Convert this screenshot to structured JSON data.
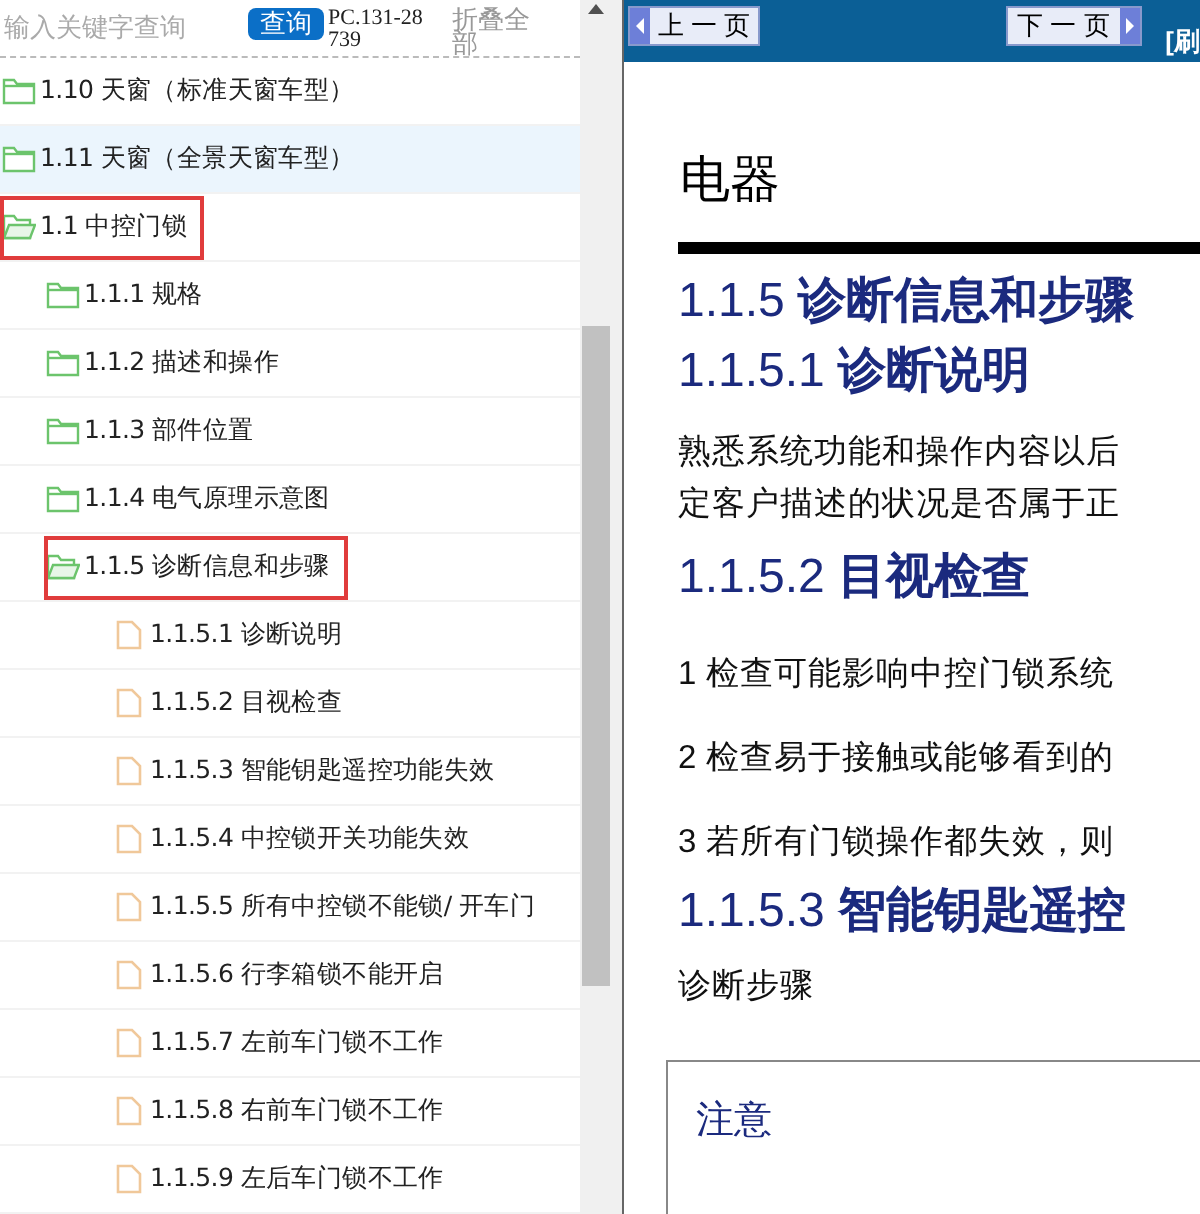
{
  "search": {
    "placeholder": "输入关键字查询",
    "button": "查询",
    "doc_code": "PC.131-28739",
    "collapse_all": "折叠全部"
  },
  "tree": [
    {
      "kind": "folder",
      "label": "1.10 天窗（标准天窗车型）",
      "expanded": false,
      "selected": false,
      "boxed": false
    },
    {
      "kind": "folder",
      "label": "1.11 天窗（全景天窗车型）",
      "expanded": false,
      "selected": true,
      "boxed": false
    },
    {
      "kind": "folder",
      "label": "1.1 中控门锁",
      "expanded": true,
      "selected": false,
      "boxed": true,
      "children": [
        {
          "kind": "folder",
          "label": "1.1.1 规格",
          "expanded": false,
          "selected": false,
          "boxed": false
        },
        {
          "kind": "folder",
          "label": "1.1.2 描述和操作",
          "expanded": false,
          "selected": false,
          "boxed": false
        },
        {
          "kind": "folder",
          "label": "1.1.3 部件位置",
          "expanded": false,
          "selected": false,
          "boxed": false
        },
        {
          "kind": "folder",
          "label": "1.1.4 电气原理示意图",
          "expanded": false,
          "selected": false,
          "boxed": false
        },
        {
          "kind": "folder",
          "label": "1.1.5 诊断信息和步骤",
          "expanded": true,
          "selected": false,
          "boxed": true,
          "children": [
            {
              "kind": "file",
              "label": "1.1.5.1 诊断说明",
              "selected": false,
              "boxed": false
            },
            {
              "kind": "file",
              "label": "1.1.5.2 目视检查",
              "selected": false,
              "boxed": false
            },
            {
              "kind": "file",
              "label": "1.1.5.3 智能钥匙遥控功能失效",
              "selected": false,
              "boxed": false
            },
            {
              "kind": "file",
              "label": "1.1.5.4 中控锁开关功能失效",
              "selected": false,
              "boxed": false
            },
            {
              "kind": "file",
              "label": "1.1.5.5 所有中控锁不能锁/ 开车门",
              "selected": false,
              "boxed": false
            },
            {
              "kind": "file",
              "label": "1.1.5.6 行李箱锁不能开启",
              "selected": false,
              "boxed": false
            },
            {
              "kind": "file",
              "label": "1.1.5.7 左前车门锁不工作",
              "selected": false,
              "boxed": false
            },
            {
              "kind": "file",
              "label": "1.1.5.8 右前车门锁不工作",
              "selected": false,
              "boxed": false
            },
            {
              "kind": "file",
              "label": "1.1.5.9 左后车门锁不工作",
              "selected": false,
              "boxed": false
            }
          ]
        }
      ]
    }
  ],
  "nav": {
    "prev": "上 一 页",
    "next": "下 一 页",
    "refresh": "[刷"
  },
  "content": [
    {
      "kind": "title",
      "text": "电器"
    },
    {
      "kind": "rule"
    },
    {
      "kind": "heading",
      "text": "1.1.5 **诊断信息和步骤**"
    },
    {
      "kind": "heading",
      "text": "1.1.5.1 **诊断说明**"
    },
    {
      "kind": "paragraph",
      "lines": [
        "熟悉系统功能和操作内容以后",
        "定客户描述的状况是否属于正"
      ]
    },
    {
      "kind": "heading",
      "text": "1.1.5.2 **目视检查**"
    },
    {
      "kind": "step",
      "text": "1 检查可能影响中控门锁系统"
    },
    {
      "kind": "step",
      "text": "2 检查易于接触或能够看到的"
    },
    {
      "kind": "step",
      "text": "3 若所有门锁操作都失效，则"
    },
    {
      "kind": "heading",
      "text": "1.1.5.3 **智能钥匙遥控**"
    },
    {
      "kind": "plain",
      "text": "诊断步骤"
    },
    {
      "kind": "note",
      "title": "注意"
    }
  ]
}
